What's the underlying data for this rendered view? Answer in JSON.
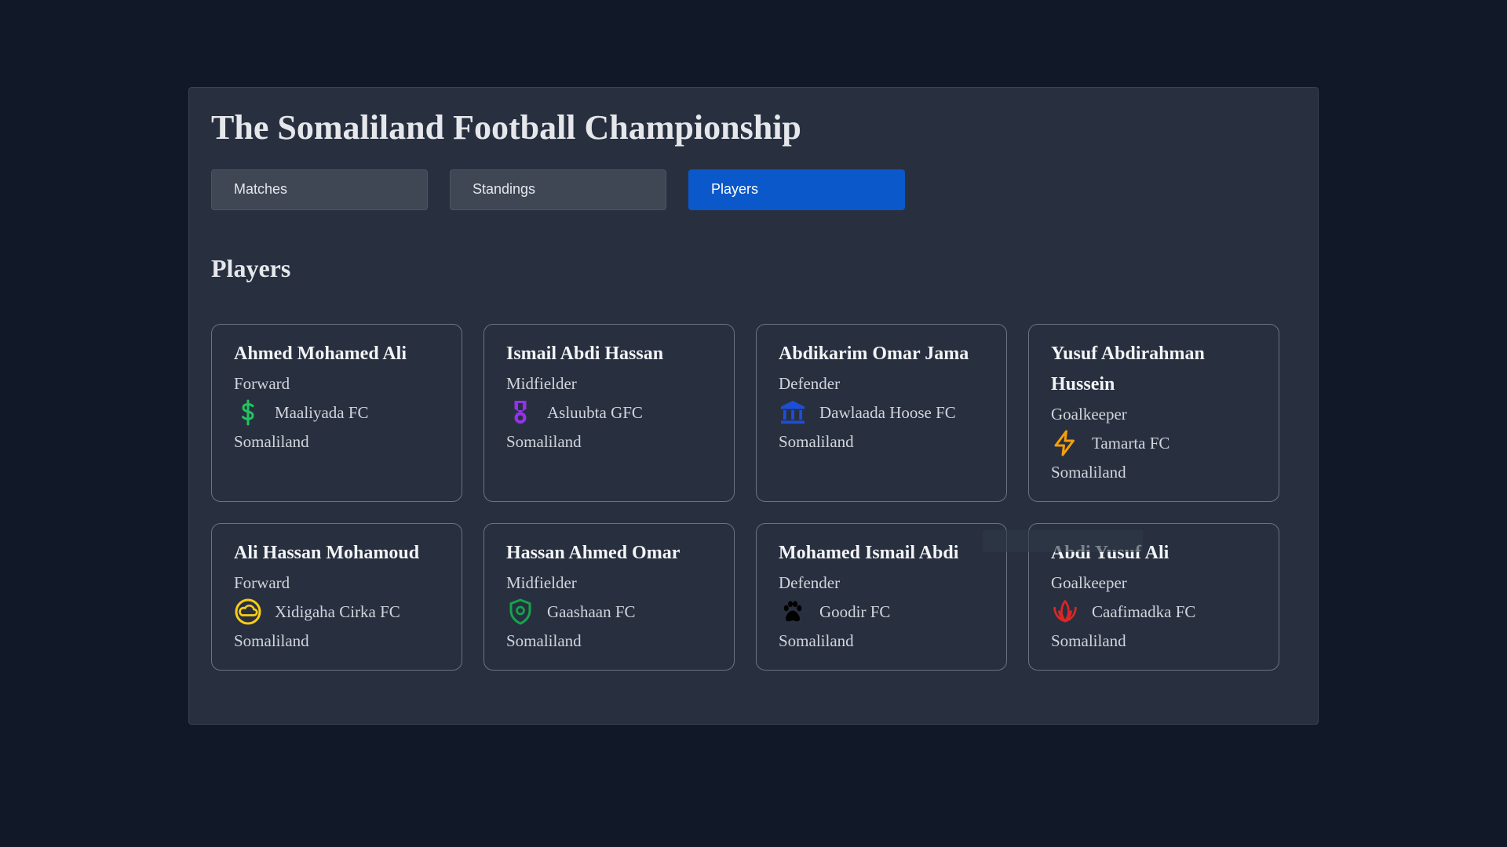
{
  "header": {
    "title": "The Somaliland Football Championship"
  },
  "tabs": [
    {
      "label": "Matches"
    },
    {
      "label": "Standings"
    },
    {
      "label": "Players"
    }
  ],
  "section": {
    "title": "Players"
  },
  "players": [
    {
      "name": "Ahmed Mohamed Ali",
      "position": "Forward",
      "club": "Maaliyada FC",
      "country": "Somaliland",
      "icon": "dollar-icon",
      "color": "#22c55e"
    },
    {
      "name": "Ismail Abdi Hassan",
      "position": "Midfielder",
      "club": "Asluubta GFC",
      "country": "Somaliland",
      "icon": "medal-icon",
      "color": "#9333ea"
    },
    {
      "name": "Abdikarim Omar Jama",
      "position": "Defender",
      "club": "Dawlaada Hoose FC",
      "country": "Somaliland",
      "icon": "building-columns-icon",
      "color": "#1d4ed8"
    },
    {
      "name": "Yusuf Abdirahman Hussein",
      "position": "Goalkeeper",
      "club": "Tamarta FC",
      "country": "Somaliland",
      "icon": "lightning-icon",
      "color": "#f59e0b"
    },
    {
      "name": "Ali Hassan Mohamoud",
      "position": "Forward",
      "club": "Xidigaha Cirka FC",
      "country": "Somaliland",
      "icon": "cloud-circle-icon",
      "color": "#facc15"
    },
    {
      "name": "Hassan Ahmed Omar",
      "position": "Midfielder",
      "club": "Gaashaan FC",
      "country": "Somaliland",
      "icon": "shield-icon",
      "color": "#16a34a"
    },
    {
      "name": "Mohamed Ismail Abdi",
      "position": "Defender",
      "club": "Goodir FC",
      "country": "Somaliland",
      "icon": "paw-icon",
      "color": "#000000"
    },
    {
      "name": "Abdi Yusuf Ali",
      "position": "Goalkeeper",
      "club": "Caafimadka FC",
      "country": "Somaliland",
      "icon": "lotus-icon",
      "color": "#dc2626"
    }
  ]
}
